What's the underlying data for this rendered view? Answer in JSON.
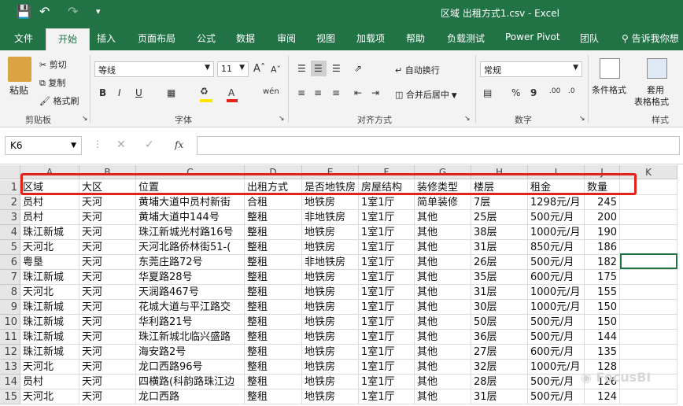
{
  "titlebar": {
    "title": "区域 出租方式1.csv  -  Excel"
  },
  "tabs": [
    "文件",
    "开始",
    "插入",
    "页面布局",
    "公式",
    "数据",
    "审阅",
    "视图",
    "加载项",
    "帮助",
    "负载测试",
    "Power Pivot",
    "团队"
  ],
  "search_tab": "告诉我你想",
  "ribbon": {
    "clipboard": {
      "paste": "粘贴",
      "cut": "剪切",
      "copy": "复制",
      "format_painter": "格式刷",
      "group": "剪贴板"
    },
    "font": {
      "name": "等线",
      "size": "11",
      "bold": "B",
      "italic": "I",
      "underline": "U",
      "group": "字体"
    },
    "alignment": {
      "wrap": "自动换行",
      "merge": "合并后居中",
      "group": "对齐方式"
    },
    "number": {
      "format": "常规",
      "percent": "%",
      "comma": "9",
      "group": "数字"
    },
    "styles": {
      "conditional": "条件格式",
      "table_format": [
        "套用",
        "表格格式"
      ],
      "group": "样式"
    }
  },
  "formula": {
    "namebox": "K6",
    "fx": "fx"
  },
  "columns": [
    "A",
    "B",
    "C",
    "D",
    "E",
    "F",
    "G",
    "H",
    "I",
    "J",
    "K"
  ],
  "rows": [
    [
      "区域",
      "大区",
      "位置",
      "出租方式",
      "是否地铁房",
      "房屋结构",
      "装修类型",
      "楼层",
      "租金",
      "数量"
    ],
    [
      "员村",
      "天河",
      "黄埔大道中员村新街",
      "合租",
      "地铁房",
      "1室1厅",
      "简单装修",
      "7层",
      "1298元/月",
      "245"
    ],
    [
      "员村",
      "天河",
      "黄埔大道中144号",
      "整租",
      "非地铁房",
      "1室1厅",
      "其他",
      "25层",
      "500元/月",
      "200"
    ],
    [
      "珠江新城",
      "天河",
      "珠江新城光村路16号",
      "整租",
      "地铁房",
      "1室1厅",
      "其他",
      "38层",
      "1000元/月",
      "190"
    ],
    [
      "天河北",
      "天河",
      "天河北路侨林街51-(",
      "整租",
      "地铁房",
      "1室1厅",
      "其他",
      "31层",
      "850元/月",
      "186"
    ],
    [
      "粤垦",
      "天河",
      "东莞庄路72号",
      "整租",
      "非地铁房",
      "1室1厅",
      "其他",
      "26层",
      "500元/月",
      "182"
    ],
    [
      "珠江新城",
      "天河",
      "华夏路28号",
      "整租",
      "地铁房",
      "1室1厅",
      "其他",
      "35层",
      "600元/月",
      "175"
    ],
    [
      "天河北",
      "天河",
      "天润路467号",
      "整租",
      "地铁房",
      "1室1厅",
      "其他",
      "31层",
      "1000元/月",
      "155"
    ],
    [
      "珠江新城",
      "天河",
      "花城大道与平江路交",
      "整租",
      "地铁房",
      "1室1厅",
      "其他",
      "30层",
      "1000元/月",
      "150"
    ],
    [
      "珠江新城",
      "天河",
      "华利路21号",
      "整租",
      "地铁房",
      "1室1厅",
      "其他",
      "50层",
      "500元/月",
      "150"
    ],
    [
      "珠江新城",
      "天河",
      "珠江新城北临兴盛路",
      "整租",
      "地铁房",
      "1室1厅",
      "其他",
      "36层",
      "500元/月",
      "144"
    ],
    [
      "珠江新城",
      "天河",
      "海安路2号",
      "整租",
      "地铁房",
      "1室1厅",
      "其他",
      "27层",
      "600元/月",
      "135"
    ],
    [
      "天河北",
      "天河",
      "龙口西路96号",
      "整租",
      "地铁房",
      "1室1厅",
      "其他",
      "32层",
      "1000元/月",
      "128"
    ],
    [
      "员村",
      "天河",
      "四横路(科韵路珠江边",
      "整租",
      "地铁房",
      "1室1厅",
      "其他",
      "28层",
      "500元/月",
      "126"
    ],
    [
      "天河北",
      "天河",
      "龙口西路",
      "整租",
      "地铁房",
      "1室1厅",
      "其他",
      "31层",
      "500元/月",
      "124"
    ]
  ],
  "watermark": "FocusBI"
}
